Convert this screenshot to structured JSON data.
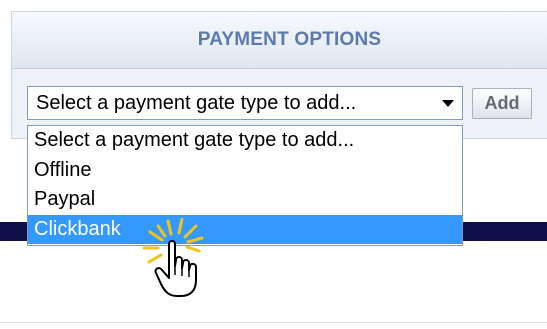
{
  "panel": {
    "title": "PAYMENT OPTIONS"
  },
  "gateway_select": {
    "selected_label": "Select a payment gate type to add...",
    "options": [
      {
        "label": "Select a payment gate type to add..."
      },
      {
        "label": "Offline"
      },
      {
        "label": "Paypal"
      },
      {
        "label": "Clickbank",
        "highlighted": true
      }
    ]
  },
  "add_button": {
    "label": "Add"
  },
  "colors": {
    "header_text": "#5b7ab0",
    "highlight": "#3399ff",
    "navy_bar": "#10104d",
    "click_burst": "#f2c316"
  },
  "icons": {
    "dropdown": "chevron-down-icon",
    "cursor": "hand-pointer-icon"
  }
}
